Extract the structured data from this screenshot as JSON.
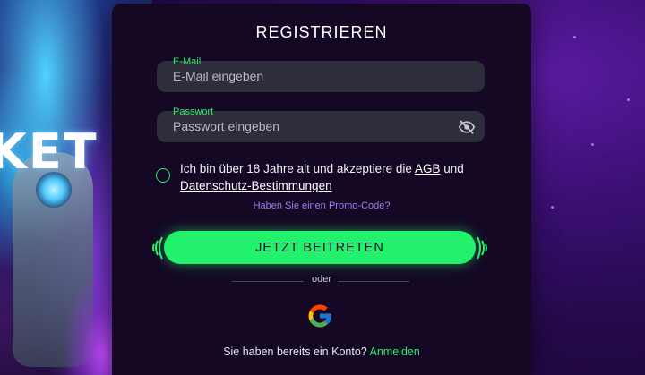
{
  "hero": {
    "text": "KET"
  },
  "form": {
    "title": "REGISTRIEREN",
    "email": {
      "label": "E-Mail",
      "placeholder": "E-Mail eingeben",
      "value": ""
    },
    "password": {
      "label": "Passwort",
      "placeholder": "Passwort eingeben",
      "value": "",
      "toggle_icon": "eye-slash-icon"
    },
    "consent": {
      "checked": false,
      "text_before": "Ich bin über 18 Jahre alt und akzeptiere die ",
      "agb_link": "AGB",
      "text_middle": " und ",
      "privacy_link": "Datenschutz-Bestimmungen"
    },
    "promo_link": "Haben Sie einen Promo-Code?",
    "submit_label": "JETZT BEITRETEN",
    "divider_text": "oder",
    "social": {
      "google_icon": "google-icon"
    },
    "footer": {
      "text": "Sie haben bereits ein Konto? ",
      "login_link": "Anmelden"
    }
  },
  "colors": {
    "accent_green": "#22f26b",
    "label_green": "#2ee86a",
    "promo_purple": "#a57bf0",
    "card_bg": "#140825",
    "field_bg": "#2e2d3b"
  }
}
